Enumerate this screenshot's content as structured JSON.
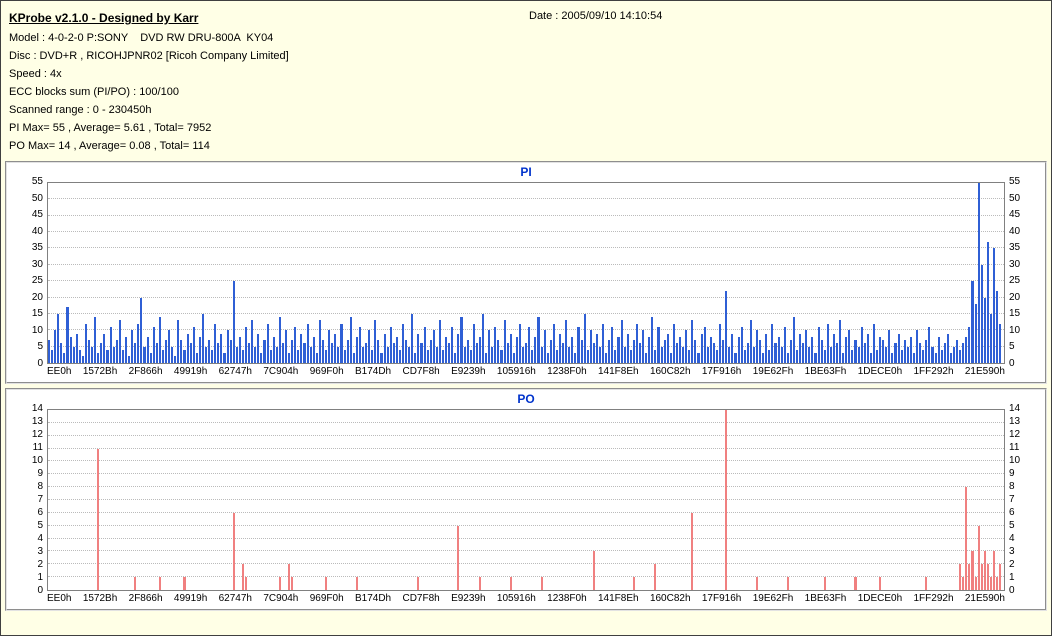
{
  "header": {
    "title": "KProbe v2.1.0 - Designed by Karr",
    "date": "Date : 2005/09/10 14:10:54",
    "info": {
      "model": "Model : 4-0-2-0 P:SONY    DVD RW DRU-800A  KY04",
      "disc": "Disc : DVD+R , RICOHJPNR02 [Ricoh Company Limited]",
      "speed": "Speed : 4x",
      "ecc": "ECC blocks sum (PI/PO) : 100/100",
      "range": "Scanned range : 0 - 230450h",
      "pi_summary": "PI Max= 55 , Average= 5.61 , Total= 7952",
      "po_summary": "PO Max= 14 , Average= 0.08 , Total= 114"
    }
  },
  "colors": {
    "background": "#FFFFE6",
    "pi_bar": "#2F5FD5",
    "po_bar": "#F08080",
    "chart_title": "#0033CC",
    "gridline": "#BBBBBB"
  },
  "chart_data": [
    {
      "type": "bar",
      "title": "PI",
      "color": "#2F5FD5",
      "ylim": [
        0,
        55
      ],
      "ytick_step": 5,
      "ylabel": "",
      "xlabel": "",
      "legend": "none",
      "grid": "horizontal-dotted",
      "x_labels": [
        "EE0h",
        "1572Bh",
        "2F866h",
        "49919h",
        "62747h",
        "7C904h",
        "969F0h",
        "B174Dh",
        "CD7F8h",
        "E9239h",
        "105916h",
        "1238F0h",
        "141F8Eh",
        "160C82h",
        "17F916h",
        "19E62Fh",
        "1BE63Fh",
        "1DECE0h",
        "1FF292h",
        "21E590h"
      ],
      "values": [
        7,
        4,
        10,
        15,
        6,
        3,
        17,
        8,
        5,
        9,
        4,
        2,
        12,
        7,
        5,
        14,
        3,
        6,
        9,
        4,
        11,
        5,
        7,
        13,
        4,
        8,
        2,
        10,
        6,
        12,
        20,
        5,
        8,
        3,
        11,
        6,
        14,
        4,
        7,
        10,
        5,
        2,
        13,
        7,
        4,
        9,
        6,
        11,
        3,
        8,
        15,
        5,
        7,
        4,
        12,
        6,
        9,
        3,
        10,
        7,
        25,
        5,
        8,
        4,
        11,
        6,
        13,
        5,
        9,
        3,
        7,
        12,
        4,
        8,
        5,
        14,
        6,
        10,
        3,
        7,
        11,
        4,
        9,
        6,
        12,
        5,
        8,
        3,
        13,
        7,
        4,
        10,
        6,
        9,
        5,
        12,
        4,
        7,
        14,
        3,
        8,
        11,
        5,
        6,
        10,
        4,
        13,
        7,
        3,
        9,
        5,
        11,
        6,
        8,
        4,
        12,
        7,
        5,
        15,
        3,
        9,
        6,
        11,
        4,
        7,
        10,
        5,
        13,
        4,
        8,
        6,
        11,
        3,
        9,
        14,
        5,
        7,
        4,
        12,
        6,
        8,
        15,
        3,
        10,
        5,
        11,
        7,
        4,
        13,
        6,
        9,
        3,
        8,
        12,
        5,
        6,
        11,
        4,
        8,
        14,
        5,
        10,
        3,
        7,
        12,
        4,
        9,
        6,
        13,
        5,
        8,
        3,
        11,
        7,
        15,
        4,
        10,
        6,
        9,
        5,
        12,
        3,
        7,
        11,
        4,
        8,
        13,
        5,
        9,
        4,
        7,
        12,
        6,
        10,
        3,
        8,
        14,
        4,
        11,
        5,
        7,
        9,
        3,
        12,
        6,
        8,
        5,
        10,
        4,
        13,
        7,
        3,
        9,
        11,
        5,
        8,
        6,
        4,
        12,
        7,
        22,
        5,
        9,
        3,
        8,
        11,
        4,
        6,
        13,
        5,
        10,
        7,
        3,
        9,
        4,
        12,
        6,
        8,
        5,
        11,
        3,
        7,
        14,
        4,
        9,
        6,
        10,
        5,
        8,
        3,
        11,
        7,
        4,
        12,
        5,
        9,
        6,
        13,
        3,
        8,
        10,
        4,
        7,
        5,
        11,
        6,
        9,
        3,
        12,
        4,
        8,
        7,
        5,
        10,
        3,
        6,
        9,
        4,
        7,
        5,
        8,
        3,
        10,
        6,
        4,
        7,
        11,
        5,
        3,
        8,
        4,
        6,
        9,
        3,
        5,
        7,
        4,
        6,
        8,
        11,
        25,
        18,
        55,
        30,
        20,
        37,
        15,
        35,
        22,
        12
      ]
    },
    {
      "type": "bar",
      "title": "PO",
      "color": "#F08080",
      "ylim": [
        0,
        14
      ],
      "ytick_step": 1,
      "ylabel": "",
      "xlabel": "",
      "legend": "none",
      "grid": "horizontal-dotted",
      "x_labels": [
        "EE0h",
        "1572Bh",
        "2F866h",
        "49919h",
        "62747h",
        "7C904h",
        "969F0h",
        "B174Dh",
        "CD7F8h",
        "E9239h",
        "105916h",
        "1238F0h",
        "141F8Eh",
        "160C82h",
        "17F916h",
        "19E62Fh",
        "1BE63Fh",
        "1DECE0h",
        "1FF292h",
        "21E590h"
      ],
      "n_bars": 310,
      "spikes": [
        [
          16,
          11
        ],
        [
          28,
          1
        ],
        [
          36,
          1
        ],
        [
          44,
          1
        ],
        [
          60,
          6
        ],
        [
          63,
          2
        ],
        [
          64,
          1
        ],
        [
          75,
          1
        ],
        [
          78,
          2
        ],
        [
          79,
          1
        ],
        [
          90,
          1
        ],
        [
          100,
          1
        ],
        [
          120,
          1
        ],
        [
          133,
          5
        ],
        [
          140,
          1
        ],
        [
          150,
          1
        ],
        [
          160,
          1
        ],
        [
          177,
          3
        ],
        [
          190,
          1
        ],
        [
          197,
          2
        ],
        [
          209,
          6
        ],
        [
          220,
          14
        ],
        [
          230,
          1
        ],
        [
          240,
          1
        ],
        [
          252,
          1
        ],
        [
          262,
          1
        ],
        [
          270,
          1
        ],
        [
          285,
          1
        ],
        [
          296,
          2
        ],
        [
          297,
          1
        ],
        [
          298,
          8
        ],
        [
          299,
          2
        ],
        [
          300,
          3
        ],
        [
          301,
          1
        ],
        [
          302,
          5
        ],
        [
          303,
          2
        ],
        [
          304,
          3
        ],
        [
          305,
          2
        ],
        [
          306,
          1
        ],
        [
          307,
          3
        ],
        [
          308,
          1
        ],
        [
          309,
          2
        ]
      ]
    }
  ]
}
